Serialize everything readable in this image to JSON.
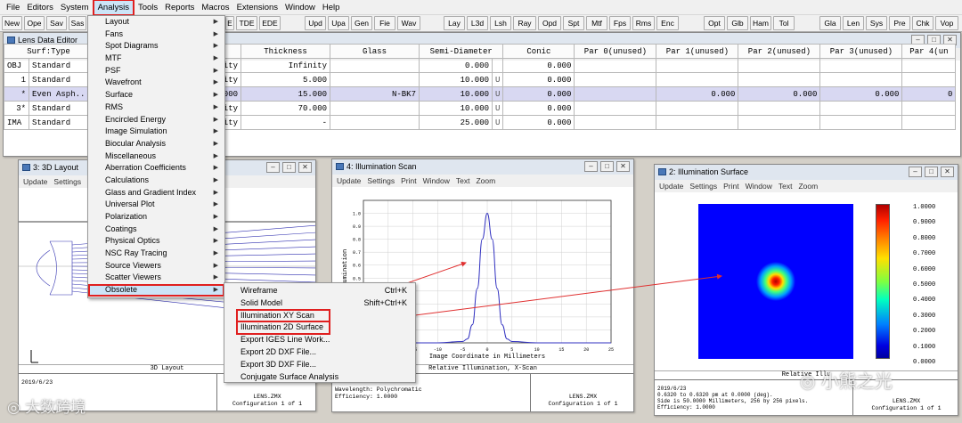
{
  "menubar": [
    "File",
    "Editors",
    "System",
    "Analysis",
    "Tools",
    "Reports",
    "Macros",
    "Extensions",
    "Window",
    "Help"
  ],
  "toolbar": [
    "New",
    "Ope",
    "Sav",
    "Sas",
    "E",
    "TDE",
    "EDE",
    "Upd",
    "Upa",
    "Gen",
    "Fie",
    "Wav",
    "Lay",
    "L3d",
    "Lsh",
    "Ray",
    "Opd",
    "Spt",
    "Mtf",
    "Fps",
    "Rms",
    "Enc",
    "Opt",
    "Glb",
    "Ham",
    "Tol",
    "Gla",
    "Len",
    "Sys",
    "Pre",
    "Chk",
    "Vop"
  ],
  "lde": {
    "title": "Lens Data Editor",
    "menu": [
      "Edit",
      "Solves",
      "View"
    ],
    "headers": [
      "Surf:Type",
      "",
      "Thickness",
      "Glass",
      "Semi-Diameter",
      "Conic",
      "Par 0(unused)",
      "Par 1(unused)",
      "Par 2(unused)",
      "Par 3(unused)",
      "Par 4(un"
    ],
    "rows": [
      [
        "OBJ",
        "Standard",
        "ity",
        "Infinity",
        "",
        "0.000",
        "",
        "0.000",
        "",
        "",
        "",
        "",
        ""
      ],
      [
        "1",
        "Standard",
        "ity",
        "5.000",
        "",
        "10.000",
        "U",
        "0.000",
        "",
        "",
        "",
        "",
        ""
      ],
      [
        "*",
        "Even Asph..",
        "000",
        "15.000",
        "N-BK7",
        "10.000",
        "U",
        "0.000",
        "",
        "0.000",
        "0.000",
        "0.000",
        "0"
      ],
      [
        "3*",
        "Standard",
        "ity",
        "70.000",
        "",
        "10.000",
        "U",
        "0.000",
        "",
        "",
        "",
        "",
        ""
      ],
      [
        "IMA",
        "Standard",
        "ity",
        "-",
        "",
        "25.000",
        "U",
        "0.000",
        "",
        "",
        "",
        "",
        ""
      ]
    ]
  },
  "analysis_menu": {
    "items": [
      "Layout",
      "Fans",
      "Spot Diagrams",
      "MTF",
      "PSF",
      "Wavefront",
      "Surface",
      "RMS",
      "Encircled Energy",
      "Image Simulation",
      "Biocular Analysis",
      "Miscellaneous",
      "Aberration Coefficients",
      "Calculations",
      "Glass and Gradient Index",
      "Universal Plot",
      "Polarization",
      "Coatings",
      "Physical Optics",
      "NSC Ray Tracing",
      "Source Viewers",
      "Scatter Viewers",
      "Obsolete"
    ],
    "selected": "Obsolete"
  },
  "obsolete_menu": {
    "items": [
      {
        "label": "Wireframe",
        "shortcut": "Ctrl+K"
      },
      {
        "label": "Solid Model",
        "shortcut": "Shift+Ctrl+K"
      },
      {
        "label": "Illumination XY Scan",
        "shortcut": ""
      },
      {
        "label": "Illumination 2D Surface",
        "shortcut": ""
      },
      {
        "label": "Export IGES Line Work...",
        "shortcut": ""
      },
      {
        "label": "Export 2D DXF File...",
        "shortcut": ""
      },
      {
        "label": "Export 3D DXF File...",
        "shortcut": ""
      },
      {
        "label": "Conjugate Surface Analysis",
        "shortcut": ""
      }
    ]
  },
  "layout_win": {
    "title": "3: 3D Layout",
    "menu": [
      "Update",
      "Settings"
    ],
    "caption": "3D Layout",
    "date": "2019/6/23",
    "file": "LENS.ZMX",
    "config": "Configuration 1 of 1"
  },
  "scan_win": {
    "title": "4: Illumination Scan",
    "menu": [
      "Update",
      "Settings",
      "Print",
      "Window",
      "Text",
      "Zoom"
    ],
    "caption": "Relative Illumination, X-Scan",
    "footer": [
      "Wavelength: Polychromatic",
      "Efficiency: 1.0000"
    ],
    "file": "LENS.ZMX",
    "config": "Configuration 1 of 1"
  },
  "surface_win": {
    "title": "2: Illumination Surface",
    "menu": [
      "Update",
      "Settings",
      "Print",
      "Window",
      "Text",
      "Zoom"
    ],
    "caption": "Relative Illu",
    "footer": [
      "2019/6/23",
      "0.6320 to 0.6320 pm at 0.0000 (deg).",
      "Side is 50.0000 Millimeters, 256 by 256 pixels.",
      "Efficiency: 1.0000"
    ],
    "file": "LENS.ZMX",
    "config": "Configuration 1 of 1",
    "colorbar_labels": [
      "1.0000",
      "0.9000",
      "0.8000",
      "0.7000",
      "0.6000",
      "0.5000",
      "0.4000",
      "0.3000",
      "0.2000",
      "0.1000",
      "0.0000"
    ]
  },
  "chart_data": {
    "type": "line",
    "title": "Relative Illumination, X-Scan",
    "xlabel": "Image Coordinate in Millimeters",
    "ylabel": "Illumination",
    "x": [
      -25,
      -20,
      -15,
      -10,
      -5,
      -4,
      -3,
      -2,
      -1,
      0,
      1,
      2,
      3,
      4,
      5,
      10,
      15,
      20,
      25
    ],
    "y": [
      0,
      0,
      0,
      0,
      0.01,
      0.03,
      0.14,
      0.42,
      0.8,
      1.0,
      0.8,
      0.42,
      0.14,
      0.03,
      0.01,
      0,
      0,
      0,
      0
    ],
    "xlim": [
      -25,
      25
    ],
    "ylim": [
      0,
      1.1
    ],
    "xticks": [
      -25,
      -20,
      -15,
      -10,
      -5,
      0,
      5,
      10,
      15,
      20,
      25
    ],
    "yticks": [
      0.1,
      0.2,
      0.3,
      0.4,
      0.5,
      0.6,
      0.7,
      0.8,
      0.9,
      1.0
    ],
    "grid": true,
    "color": "#3030c0"
  },
  "watermark": {
    "left": "大数跨境",
    "right": "小熊之光"
  },
  "colors": {
    "highlight_box": "#e02020",
    "arrow": "#e03030",
    "menu_highlight": "#cce4f7",
    "selected_row": "#d8d8f2"
  }
}
